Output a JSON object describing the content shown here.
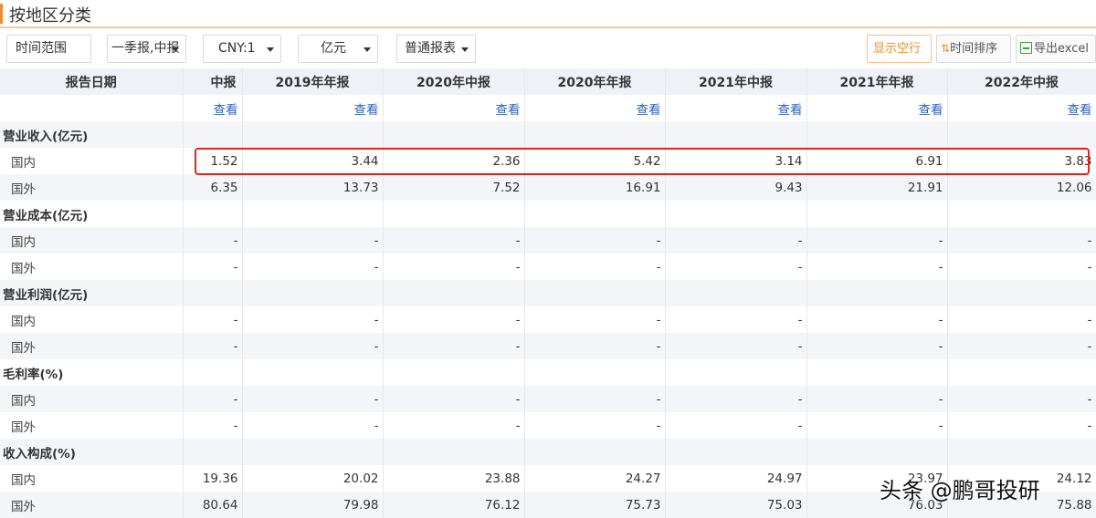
{
  "page": {
    "title": "按地区分类"
  },
  "toolbar": {
    "time_range": "时间范围",
    "report_type": "一季报,中报",
    "currency": "CNY:1",
    "unit": "亿元",
    "statement": "普通报表",
    "show_blank": "显示空行",
    "sort_glyph": "⇅",
    "sort_label": "时间排序",
    "export_label": "导出excel"
  },
  "table": {
    "header_label": "报告日期",
    "columns": [
      "中报",
      "2019年年报",
      "2020年中报",
      "2020年年报",
      "2021年中报",
      "2021年年报",
      "2022年中报"
    ],
    "view_label": "查看",
    "rows": [
      {
        "kind": "section",
        "label": "营业收入(亿元)"
      },
      {
        "kind": "data",
        "label": "国内",
        "values": [
          "1.52",
          "3.44",
          "2.36",
          "5.42",
          "3.14",
          "6.91",
          "3.83"
        ]
      },
      {
        "kind": "data",
        "label": "国外",
        "values": [
          "6.35",
          "13.73",
          "7.52",
          "16.91",
          "9.43",
          "21.91",
          "12.06"
        ]
      },
      {
        "kind": "section",
        "label": "营业成本(亿元)"
      },
      {
        "kind": "data",
        "label": "国内",
        "values": [
          "-",
          "-",
          "-",
          "-",
          "-",
          "-",
          "-"
        ]
      },
      {
        "kind": "data",
        "label": "国外",
        "values": [
          "-",
          "-",
          "-",
          "-",
          "-",
          "-",
          "-"
        ]
      },
      {
        "kind": "section",
        "label": "营业利润(亿元)"
      },
      {
        "kind": "data",
        "label": "国内",
        "values": [
          "-",
          "-",
          "-",
          "-",
          "-",
          "-",
          "-"
        ]
      },
      {
        "kind": "data",
        "label": "国外",
        "values": [
          "-",
          "-",
          "-",
          "-",
          "-",
          "-",
          "-"
        ]
      },
      {
        "kind": "section",
        "label": "毛利率(%)"
      },
      {
        "kind": "data",
        "label": "国内",
        "values": [
          "-",
          "-",
          "-",
          "-",
          "-",
          "-",
          "-"
        ]
      },
      {
        "kind": "data",
        "label": "国外",
        "values": [
          "-",
          "-",
          "-",
          "-",
          "-",
          "-",
          "-"
        ]
      },
      {
        "kind": "section",
        "label": "收入构成(%)"
      },
      {
        "kind": "data",
        "label": "国内",
        "values": [
          "19.36",
          "20.02",
          "23.88",
          "24.27",
          "24.97",
          "23.97",
          "24.12"
        ]
      },
      {
        "kind": "data",
        "label": "国外",
        "values": [
          "80.64",
          "79.98",
          "76.12",
          "75.73",
          "75.03",
          "76.03",
          "75.88"
        ]
      }
    ]
  },
  "watermark": "头条 @鹏哥投研",
  "colors": {
    "accent": "#f08a24",
    "link": "#2e62b9",
    "highlight": "#e0241b",
    "header_bg": "#eef1f6"
  }
}
